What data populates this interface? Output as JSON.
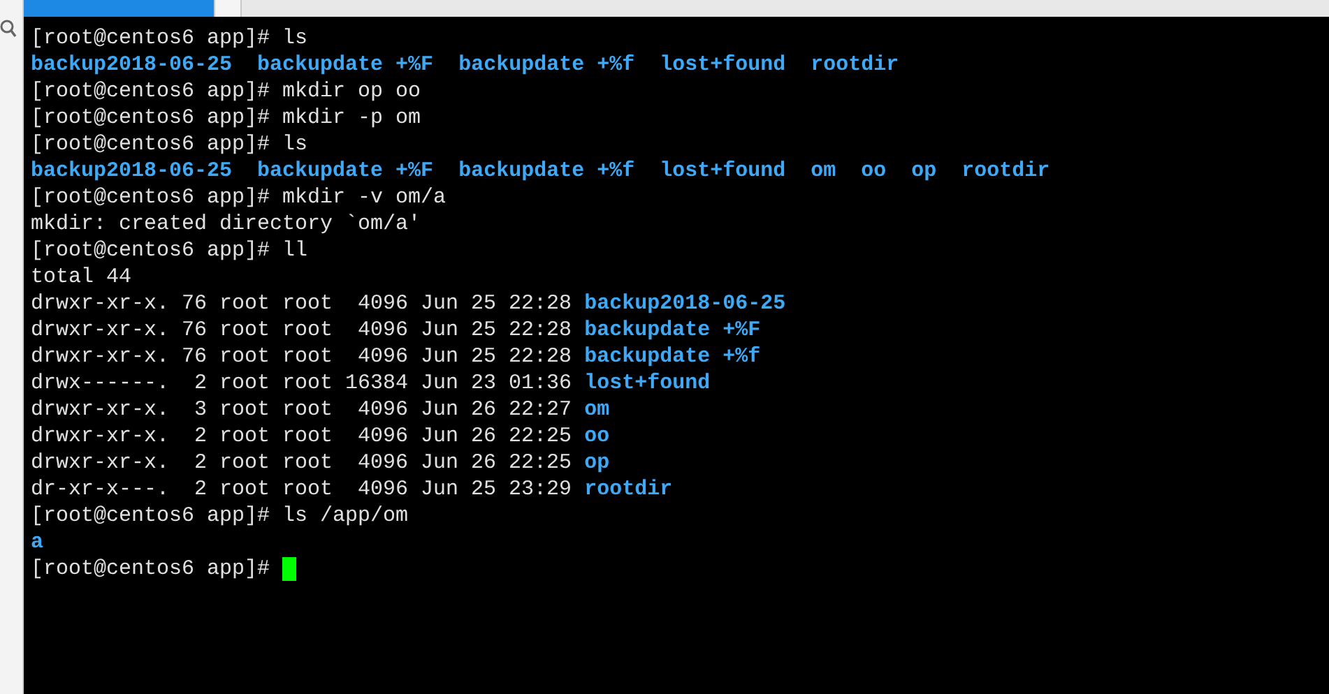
{
  "terminal": {
    "lines": [
      {
        "kind": "text",
        "segments": [
          {
            "kind": "plain",
            "text": "[root@centos6 app]# ls"
          }
        ]
      },
      {
        "kind": "listing",
        "segments": [
          {
            "kind": "dir",
            "text": "backup2018-06-25"
          },
          {
            "kind": "dir",
            "text": "backupdate +%F"
          },
          {
            "kind": "dir",
            "text": "backupdate +%f"
          },
          {
            "kind": "dir",
            "text": "lost+found"
          },
          {
            "kind": "dir",
            "text": "rootdir"
          }
        ]
      },
      {
        "kind": "text",
        "segments": [
          {
            "kind": "plain",
            "text": "[root@centos6 app]# mkdir op oo"
          }
        ]
      },
      {
        "kind": "text",
        "segments": [
          {
            "kind": "plain",
            "text": "[root@centos6 app]# mkdir -p om"
          }
        ]
      },
      {
        "kind": "text",
        "segments": [
          {
            "kind": "plain",
            "text": "[root@centos6 app]# ls"
          }
        ]
      },
      {
        "kind": "listing",
        "segments": [
          {
            "kind": "dir",
            "text": "backup2018-06-25"
          },
          {
            "kind": "dir",
            "text": "backupdate +%F"
          },
          {
            "kind": "dir",
            "text": "backupdate +%f"
          },
          {
            "kind": "dir",
            "text": "lost+found"
          },
          {
            "kind": "dir",
            "text": "om"
          },
          {
            "kind": "dir",
            "text": "oo"
          },
          {
            "kind": "dir",
            "text": "op"
          },
          {
            "kind": "dir",
            "text": "rootdir"
          }
        ]
      },
      {
        "kind": "text",
        "segments": [
          {
            "kind": "plain",
            "text": "[root@centos6 app]# mkdir -v om/a"
          }
        ]
      },
      {
        "kind": "text",
        "segments": [
          {
            "kind": "plain",
            "text": "mkdir: created directory `om/a'"
          }
        ]
      },
      {
        "kind": "text",
        "segments": [
          {
            "kind": "plain",
            "text": "[root@centos6 app]# ll"
          }
        ]
      },
      {
        "kind": "text",
        "segments": [
          {
            "kind": "plain",
            "text": "total 44"
          }
        ]
      },
      {
        "kind": "text",
        "segments": [
          {
            "kind": "plain",
            "text": "drwxr-xr-x. 76 root root  4096 Jun 25 22:28"
          },
          {
            "kind": "dir",
            "text": "backup2018-06-25"
          }
        ]
      },
      {
        "kind": "text",
        "segments": [
          {
            "kind": "plain",
            "text": "drwxr-xr-x. 76 root root  4096 Jun 25 22:28"
          },
          {
            "kind": "dir",
            "text": "backupdate +%F"
          }
        ]
      },
      {
        "kind": "text",
        "segments": [
          {
            "kind": "plain",
            "text": "drwxr-xr-x. 76 root root  4096 Jun 25 22:28"
          },
          {
            "kind": "dir",
            "text": "backupdate +%f"
          }
        ]
      },
      {
        "kind": "text",
        "segments": [
          {
            "kind": "plain",
            "text": "drwx------.  2 root root 16384 Jun 23 01:36"
          },
          {
            "kind": "dir",
            "text": "lost+found"
          }
        ]
      },
      {
        "kind": "text",
        "segments": [
          {
            "kind": "plain",
            "text": "drwxr-xr-x.  3 root root  4096 Jun 26 22:27"
          },
          {
            "kind": "dir",
            "text": "om"
          }
        ]
      },
      {
        "kind": "text",
        "segments": [
          {
            "kind": "plain",
            "text": "drwxr-xr-x.  2 root root  4096 Jun 26 22:25"
          },
          {
            "kind": "dir",
            "text": "oo"
          }
        ]
      },
      {
        "kind": "text",
        "segments": [
          {
            "kind": "plain",
            "text": "drwxr-xr-x.  2 root root  4096 Jun 26 22:25"
          },
          {
            "kind": "dir",
            "text": "op"
          }
        ]
      },
      {
        "kind": "text",
        "segments": [
          {
            "kind": "plain",
            "text": "dr-xr-x---.  2 root root  4096 Jun 25 23:29"
          },
          {
            "kind": "dir",
            "text": "rootdir"
          }
        ]
      },
      {
        "kind": "text",
        "segments": [
          {
            "kind": "plain",
            "text": "[root@centos6 app]# ls /app/om"
          }
        ]
      },
      {
        "kind": "text",
        "segments": [
          {
            "kind": "dir",
            "text": "a"
          }
        ]
      },
      {
        "kind": "prompt",
        "segments": [
          {
            "kind": "plain",
            "text": "[root@centos6 app]#"
          }
        ]
      }
    ]
  }
}
